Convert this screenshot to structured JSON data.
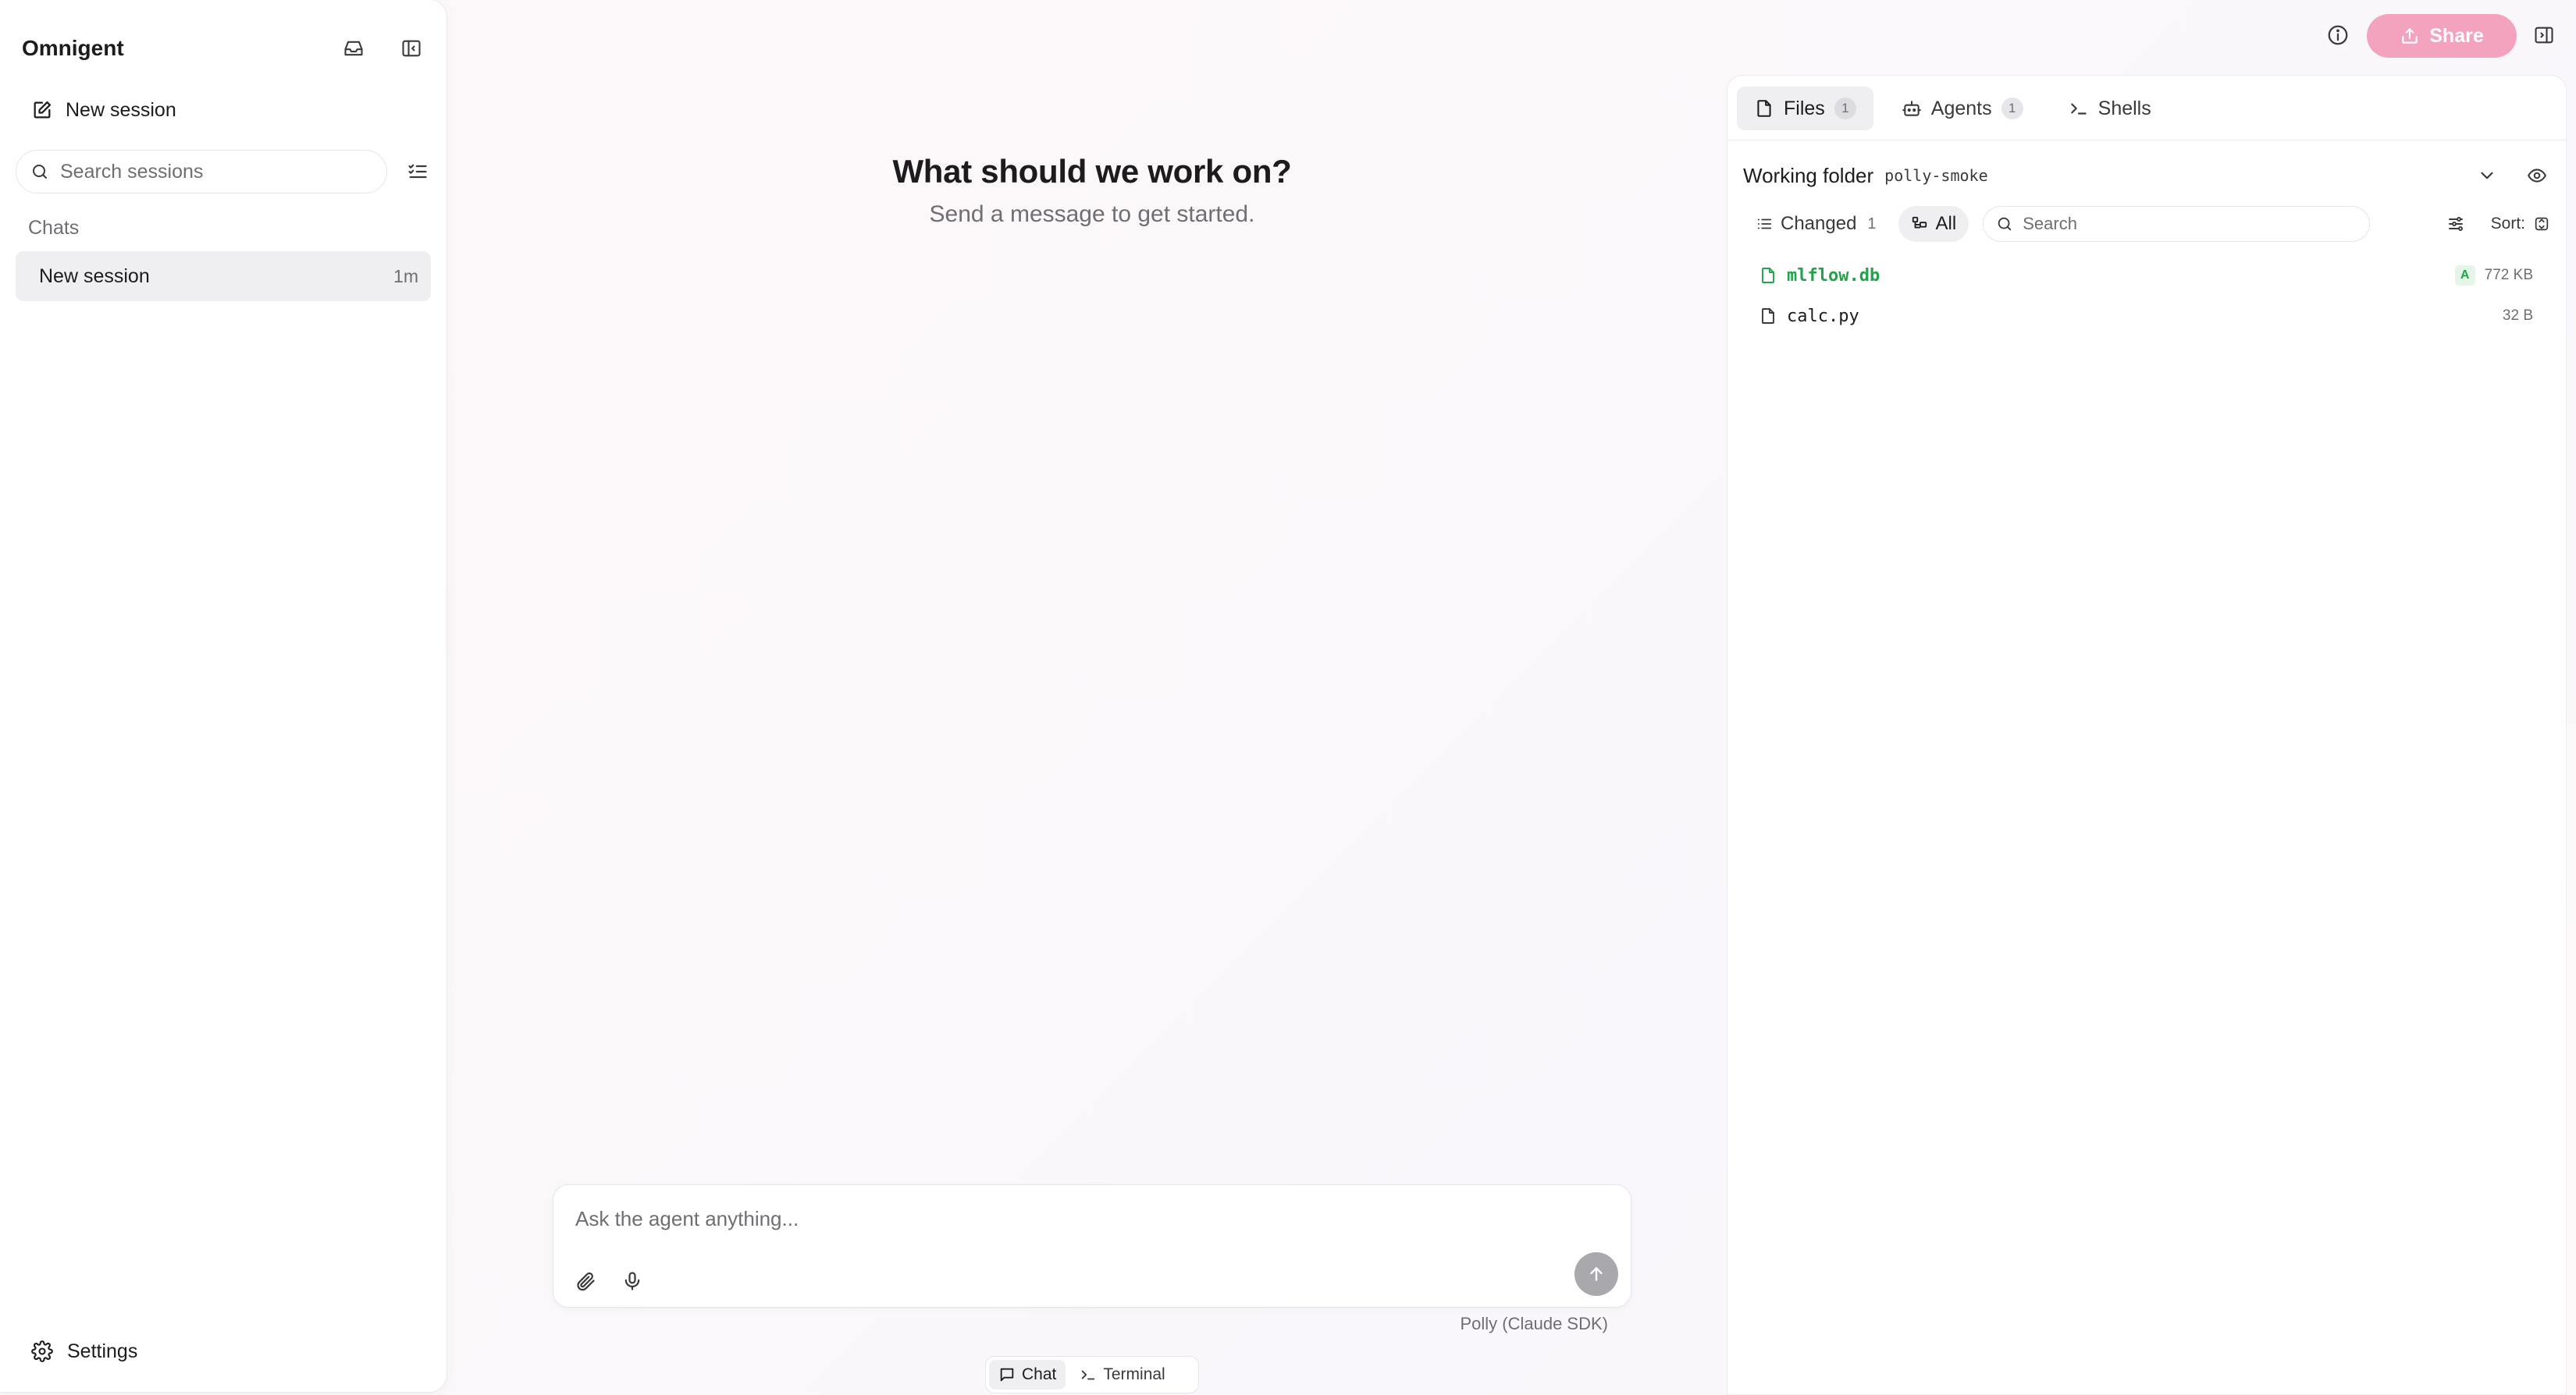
{
  "app": {
    "title": "Omnigent"
  },
  "sidebar": {
    "new_session_label": "New session",
    "search_placeholder": "Search sessions",
    "section_label": "Chats",
    "sessions": [
      {
        "label": "New session",
        "time": "1m"
      }
    ],
    "settings_label": "Settings"
  },
  "main": {
    "title": "What should we work on?",
    "subtitle": "Send a message to get started.",
    "composer_placeholder": "Ask the agent anything...",
    "model_label": "Polly (Claude SDK)",
    "modes": [
      {
        "label": "Chat",
        "active": true
      },
      {
        "label": "Terminal",
        "active": false
      }
    ]
  },
  "header": {
    "share_label": "Share"
  },
  "panel": {
    "tabs": [
      {
        "label": "Files",
        "count": "1",
        "active": true
      },
      {
        "label": "Agents",
        "count": "1",
        "active": false
      },
      {
        "label": "Shells",
        "active": false
      }
    ],
    "working_folder_label": "Working folder",
    "working_folder_name": "polly-smoke",
    "filters": {
      "changed_label": "Changed",
      "changed_count": "1",
      "all_label": "All",
      "search_placeholder": "Search",
      "sort_label": "Sort:"
    },
    "files": [
      {
        "name": "mlflow.db",
        "status": "A",
        "size": "772 KB"
      },
      {
        "name": "calc.py",
        "status": "",
        "size": "32 B"
      }
    ]
  },
  "colors": {
    "accent": "#f3a3bd",
    "added": "#22a34a",
    "send_disabled": "#a9a9ad"
  },
  "icons": {
    "inbox": "inbox-icon",
    "sidebar_toggle": "sidebar-toggle-icon",
    "edit": "edit-icon",
    "search": "search-icon",
    "filter_list": "checklist-icon",
    "settings": "gear-icon",
    "attach": "paperclip-icon",
    "mic": "microphone-icon",
    "send": "arrow-up-icon",
    "info": "info-icon",
    "share": "share-icon",
    "file": "file-icon",
    "agent": "robot-icon",
    "shell": "terminal-icon",
    "chevron": "chevron-down-icon",
    "eye": "eye-icon",
    "sort": "sort-icon"
  }
}
